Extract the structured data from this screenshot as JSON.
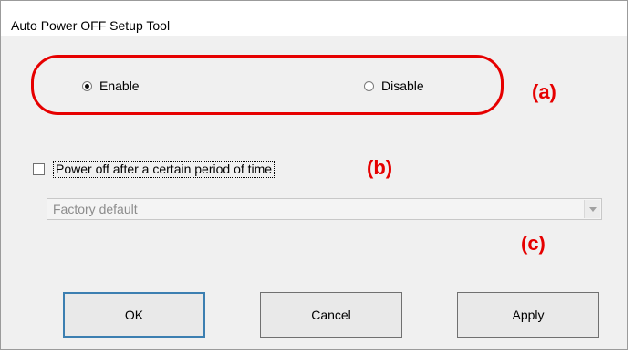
{
  "window": {
    "title": "Auto Power OFF Setup Tool"
  },
  "mode": {
    "enable_label": "Enable",
    "disable_label": "Disable",
    "selected": "Enable"
  },
  "power_off": {
    "checkbox_label": "Power off after a certain period of time",
    "checked": false,
    "select_value": "Factory default",
    "select_enabled": false
  },
  "annotations": {
    "a": "(a)",
    "b": "(b)",
    "c": "(c)"
  },
  "buttons": {
    "ok": "OK",
    "cancel": "Cancel",
    "apply": "Apply"
  },
  "colors": {
    "annotation_red": "#e60000",
    "dialog_bg": "#f0f0f0",
    "default_button_border": "#3c7fb1"
  }
}
